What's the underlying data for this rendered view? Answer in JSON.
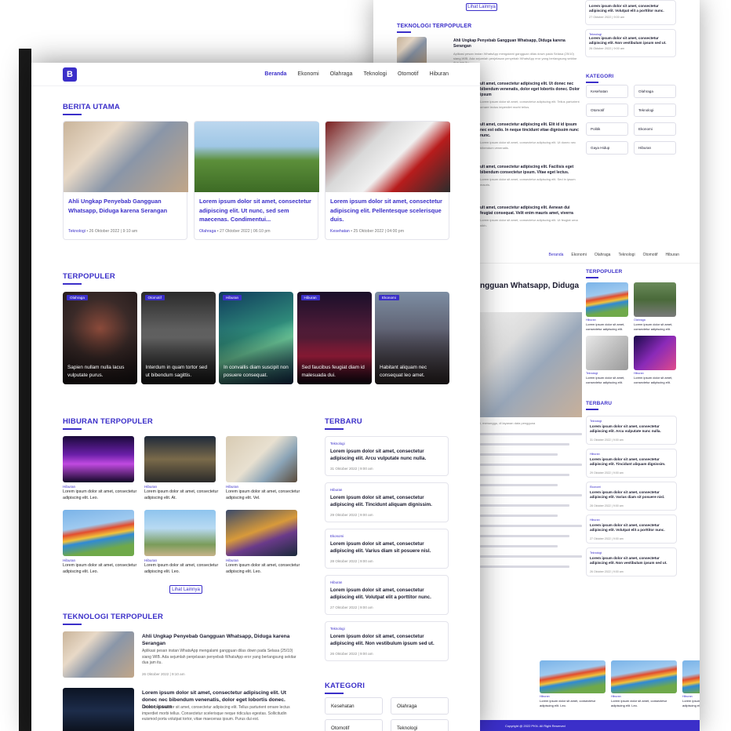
{
  "brand": {
    "logo_letter": "B",
    "accent": "#3b2fc9",
    "footer_color": "#3b2fc9"
  },
  "nav": {
    "items": [
      "Beranda",
      "Ekonomi",
      "Olahraga",
      "Teknologi",
      "Otomotif",
      "Hiburan"
    ]
  },
  "front": {
    "berita_utama": {
      "title": "BERITA UTAMA",
      "cards": [
        {
          "title": "Ahli Ungkap Penyebab Gangguan Whatsapp, Diduga karena Serangan",
          "category": "Teknologi",
          "meta": " • 26 Oktober 2022 | 9:10 am"
        },
        {
          "title": "Lorem ipsum dolor sit amet, consectetur adipiscing elit. Ut nunc, sed sem maecenas. Condimentui...",
          "category": "Olahraga",
          "meta": " • 27 Oktober 2022 | 06:10 pm"
        },
        {
          "title": "Lorem ipsum dolor sit amet, consectetur adipiscing elit. Pellentesque scelerisque duis.",
          "category": "Kesehatan",
          "meta": " • 25 Oktober 2022 | 04:00 pm"
        }
      ]
    },
    "terpopuler": {
      "title": "TERPOPULER",
      "cards": [
        {
          "badge": "Olahraga",
          "text": "Sapien nullam nulla lacus vulputate purus."
        },
        {
          "badge": "Otomotif",
          "text": "Interdum in quam tortor sed ut bibendum sagittis."
        },
        {
          "badge": "Hiburan",
          "text": "In convallis diam suscipit non posuere consequat."
        },
        {
          "badge": "Hiburan",
          "text": "Sed faucibus feugiat diam id malesuada dui."
        },
        {
          "badge": "Ekonomi",
          "text": "Habitant aliquam nec consequat leo amet."
        }
      ]
    },
    "hiburan": {
      "title": "HIBURAN TERPOPULER",
      "items": [
        {
          "category": "Hiburan",
          "text": "Lorem ipsum dolor sit amet, consectetur adipiscing elit. Leo."
        },
        {
          "category": "Hiburan",
          "text": "Lorem ipsum dolor sit amet, consectetur adipiscing elit. At."
        },
        {
          "category": "Hiburan",
          "text": "Lorem ipsum dolor sit amet, consectetur adipiscing elit. Vel."
        },
        {
          "category": "Hiburan",
          "text": "Lorem ipsum dolor sit amet, consectetur adipiscing elit. Leo."
        },
        {
          "category": "Hiburan",
          "text": "Lorem ipsum dolor sit amet, consectetur adipiscing elit. Leo."
        },
        {
          "category": "Hiburan",
          "text": "Lorem ipsum dolor sit amet, consectetur adipiscing elit. Leo."
        }
      ],
      "more_label": "Lihat Lainnya"
    },
    "terbaru": {
      "title": "TERBARU",
      "items": [
        {
          "category": "Teknologi",
          "text": "Lorem ipsum dolor sit amet, consectetur adipiscing elit. Arcu vulputate nunc nulla.",
          "date": "31 Oktober 2022 | 9:00 am"
        },
        {
          "category": "Hiburan",
          "text": "Lorem ipsum dolor sit amet, consectetur adipiscing elit. Tincidunt aliquam dignissim.",
          "date": "29 Oktober 2022 | 9:00 am"
        },
        {
          "category": "Ekonomi",
          "text": "Lorem ipsum dolor sit amet, consectetur adipiscing elit. Varius diam sit posuere nisl.",
          "date": "28 Oktober 2022 | 9:00 am"
        },
        {
          "category": "Hiburan",
          "text": "Lorem ipsum dolor sit amet, consectetur adipiscing elit. Volutpat elit a porttitor nunc.",
          "date": "27 Oktober 2022 | 9:00 am"
        },
        {
          "category": "Teknologi",
          "text": "Lorem ipsum dolor sit amet, consectetur adipiscing elit. Non vestibulum ipsum sed ut.",
          "date": "26 Oktober 2022 | 9:00 am"
        }
      ]
    },
    "teknologi": {
      "title": "TEKNOLOGI TERPOPULER",
      "items": [
        {
          "title": "Ahli Ungkap Penyebab Gangguan Whatsapp, Diduga karena Serangan",
          "body": "Aplikasi pesan instan WhatsApp mengalami gangguan dilas down pada Selasa (25/10) siang WIB. Ada sejumlah penjelasan penyebab WhatsApp eror yang berlangsung sekitar dua jam itu.",
          "date": "26 Oktober 2022 | 9:10 am"
        },
        {
          "title": "Lorem ipsum dolor sit amet, consectetur adipiscing elit. Ut donec nec bibendum venenatis, dolor eget lobortis donec. Dolor ipsum",
          "body": "Lorem ipsum dolor sit amet, consectetur adipiscing elit. Tellus parturient ornare lectus imperdiet morbi tellus. Consectetur scelerisque neque ridiculus egestas. Sollicitudin euismod porta volutpat tortor, vitae maecenas ipsum. Purus dui est.",
          "date": ""
        }
      ]
    },
    "kategori": {
      "title": "KATEGORI",
      "items": [
        "Kesehatan",
        "Olahraga",
        "Otomotif",
        "Teknologi"
      ]
    }
  },
  "back": {
    "more_label": "Lihat Lainnya",
    "teknologi_title": "TEKNOLOGI TERPOPULER",
    "teknologi_first": "Ahli Ungkap Penyebab Gangguan Whatsapp, Diduga karena Serangan",
    "teknologi_first_body": "Aplikasi pesan instan WhatsApp mengalami gangguan dilas down pada Selasa (25/10) siang WIB. Ada sejumlah penjelasan penyebab WhatsApp eror yang berlangsung sekitar dua jam itu.",
    "list_snippets": [
      "ult amet, consectetur adipiscing elit. Ut donec nec bibendum venenatis, dolor eget lobortis donec. Dolor ipsum",
      "ult amet, consectetur adipiscing elit. Elit id id ipsum nec est odio. In neque tincidunt vitae dignissim nunc nunc.",
      "ult amet, consectetur adipiscing elit. Facilisis eget bibendum consectetur ipsum. Vitae eget lectus.",
      "ult amet, consectetur adipiscing elit. Aenean dui feugiat consequat. Velit enim mauris amet, viverra"
    ],
    "top_right_items": [
      {
        "text": "Lorem ipsum dolor sit amet, consectetur adipiscing elit. Volutpat elit a porttitor nunc.",
        "date": "27 Oktober 2022 | 9:00 am"
      },
      {
        "category": "Teknologi",
        "text": "Lorem ipsum dolor sit amet, consectetur adipiscing elit. Non vestibulum ipsum sed ut.",
        "date": "26 Oktober 2022 | 9:00 am"
      }
    ],
    "kategori_title": "KATEGORI",
    "kategori": [
      "Kesehatan",
      "Olahraga",
      "Otomotif",
      "Teknologi",
      "Politik",
      "Ekonomi",
      "Gaya Hidup",
      "Hiburan"
    ],
    "nav": [
      "Beranda",
      "Ekonomi",
      "Olahraga",
      "Teknologi",
      "Otomotif",
      "Hiburan"
    ],
    "article_title": "ngguan Whatsapp, Diduga",
    "terpopuler_title": "TERPOPULER",
    "terpopuler_items": [
      {
        "category": "Hiburan",
        "text": "Lorem ipsum dolor sit amet, consectetur adipiscing elit."
      },
      {
        "category": "Olahraga",
        "text": "Lorem ipsum dolor sit amet, consectetur adipiscing elit."
      },
      {
        "category": "Teknologi",
        "text": "Lorem ipsum dolor sit amet, consectetur adipiscing elit."
      },
      {
        "category": "Hiburan",
        "text": "Lorem ipsum dolor sit amet, consectetur adipiscing elit."
      }
    ],
    "terbaru_title": "TERBARU",
    "terbaru_items": [
      {
        "category": "Teknologi",
        "text": "Lorem ipsum dolor sit amet, consectetur adipiscing elit. Arcu vulputate nunc nulla.",
        "date": "31 Oktober 2022 | 9:00 am"
      },
      {
        "category": "Hiburan",
        "text": "Lorem ipsum dolor sit amet, consectetur adipiscing elit. Tincidunt aliquam dignissim.",
        "date": "29 Oktober 2022 | 9:00 am"
      },
      {
        "category": "Ekonomi",
        "text": "Lorem ipsum dolor sit amet, consectetur adipiscing elit. Varius diam sit posuere nisl.",
        "date": "28 Oktober 2022 | 9:00 am"
      },
      {
        "category": "Hiburan",
        "text": "Lorem ipsum dolor sit amet, consectetur adipiscing elit. Volutpat elit a porttitor nunc.",
        "date": "27 Oktober 2022 | 9:00 am"
      },
      {
        "category": "Teknologi",
        "text": "Lorem ipsum dolor sit amet, consectetur adipiscing elit. Non vestibulum ipsum sed ut.",
        "date": "26 Oktober 2022 | 9:00 am"
      }
    ],
    "bottom_items": [
      {
        "category": "Hiburan",
        "text": "Lorem ipsum dolor sit amet, consectetur adipiscing elit. Leo."
      },
      {
        "category": "Hiburan",
        "text": "Lorem ipsum dolor sit amet, consectetur adipiscing elit. Leo."
      },
      {
        "category": "Hiburan",
        "text": "Lorem ipsum dolor sit amet, consectetur adipiscing elit. Leo."
      }
    ],
    "footer": "Copyright @ 2022 PKN. All Right Reserved"
  }
}
